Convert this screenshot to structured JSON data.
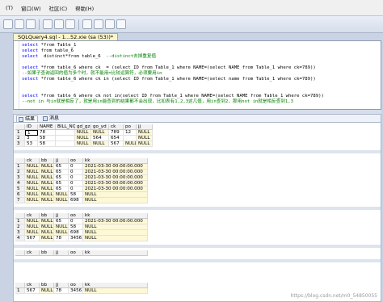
{
  "menu": [
    "(T)",
    "窗口(W)",
    "社区(C)",
    "帮助(H)"
  ],
  "doc_tab": "SQLQuery4.sql - 1...52.xie (sa (53))*",
  "editor": {
    "lines": [
      {
        "kw": "select",
        "rest": " *from Table_1",
        "cm": ""
      },
      {
        "kw": "select",
        "rest": " from table_6",
        "cm": ""
      },
      {
        "kw": "select",
        "rest": "  distinct*from table_6",
        "cm": "  --distinct去掉重复值"
      },
      {
        "kw": "",
        "rest": "",
        "cm": ""
      },
      {
        "kw": "select",
        "rest": " *from table_6 where ck  = (select ID from Table_1 where NAME=(select NAME from Table_1 where ck=789))",
        "cm": ""
      },
      {
        "kw": "",
        "rest": "",
        "cm": "--如果子查询返回的值为多个时，就不能用=比较运算符，必须要用in"
      },
      {
        "kw": "select",
        "rest": " *from table_6 where ck in (select ID from Table_1 where NAME=(select name from Table_1 where ck=789))",
        "cm": ""
      },
      {
        "kw": "",
        "rest": "",
        "cm": ""
      },
      {
        "kw": "",
        "rest": "",
        "cm": ""
      },
      {
        "kw": "select",
        "rest": " *from table_6 where ck not in(select ID from Table_1 where NAME=(select NAME from Table_1 where ck=789))",
        "cm": ""
      },
      {
        "kw": "",
        "rest": "",
        "cm": "--not in 与in就是相反了，就是用in能查到的结果都不会出现，比如表有1,2,3这几值，用in查到2，那用not in就是相反查到1,3"
      }
    ]
  },
  "result_tabs": {
    "results": "结果",
    "messages": "消息"
  },
  "grids": [
    {
      "columns": [
        "",
        "ID",
        "NAME",
        "BILL_NO",
        "gd_gz",
        "go_yd",
        "ck",
        "po",
        "jj"
      ],
      "rows": [
        [
          "1",
          "1",
          "78",
          "",
          "NULL",
          "NULL",
          "789",
          "12",
          "NULL"
        ],
        [
          "2",
          "3",
          "58",
          "",
          "NULL",
          "564",
          "654",
          "",
          "NULL"
        ],
        [
          "3",
          "53",
          "58",
          "",
          "NULL",
          "NULL",
          "567",
          "NULL",
          "NULL"
        ]
      ]
    },
    {
      "columns": [
        "",
        "ck",
        "bb",
        "jj",
        "oo",
        "kk"
      ],
      "rows": [
        [
          "1",
          "NULL",
          "NULL",
          "65",
          "0",
          "2021-03-30 00:00:00.000"
        ],
        [
          "2",
          "NULL",
          "NULL",
          "65",
          "0",
          "2021-03-30 00:00:00.000"
        ],
        [
          "3",
          "NULL",
          "NULL",
          "65",
          "0",
          "2021-03-30 00:00:00.000"
        ],
        [
          "4",
          "NULL",
          "NULL",
          "65",
          "0",
          "2021-03-30 00:00:00.000"
        ],
        [
          "5",
          "NULL",
          "NULL",
          "65",
          "0",
          "2021-03-30 00:00:00.000"
        ],
        [
          "6",
          "NULL",
          "NULL",
          "NULL",
          "58",
          "NULL"
        ],
        [
          "7",
          "NULL",
          "NULL",
          "NULL",
          "698",
          "NULL"
        ]
      ]
    },
    {
      "columns": [
        "",
        "ck",
        "bb",
        "jj",
        "oo",
        "kk"
      ],
      "rows": [
        [
          "1",
          "NULL",
          "NULL",
          "65",
          "0",
          "2021-03-30 00:00:00.000"
        ],
        [
          "2",
          "NULL",
          "NULL",
          "NULL",
          "58",
          "NULL"
        ],
        [
          "3",
          "NULL",
          "NULL",
          "NULL",
          "698",
          "NULL"
        ],
        [
          "4",
          "567",
          "NULL",
          "78",
          "3456",
          "NULL"
        ]
      ]
    },
    {
      "columns": [
        "",
        "ck",
        "bb",
        "jj",
        "oo",
        "kk"
      ],
      "rows": []
    },
    {
      "columns": [
        "",
        "ck",
        "bb",
        "jj",
        "oo",
        "kk"
      ],
      "rows": [
        [
          "1",
          "567",
          "NULL",
          "78",
          "3456",
          "NULL"
        ]
      ]
    }
  ],
  "watermark": "https://blog.csdn.net/m0_54850055"
}
